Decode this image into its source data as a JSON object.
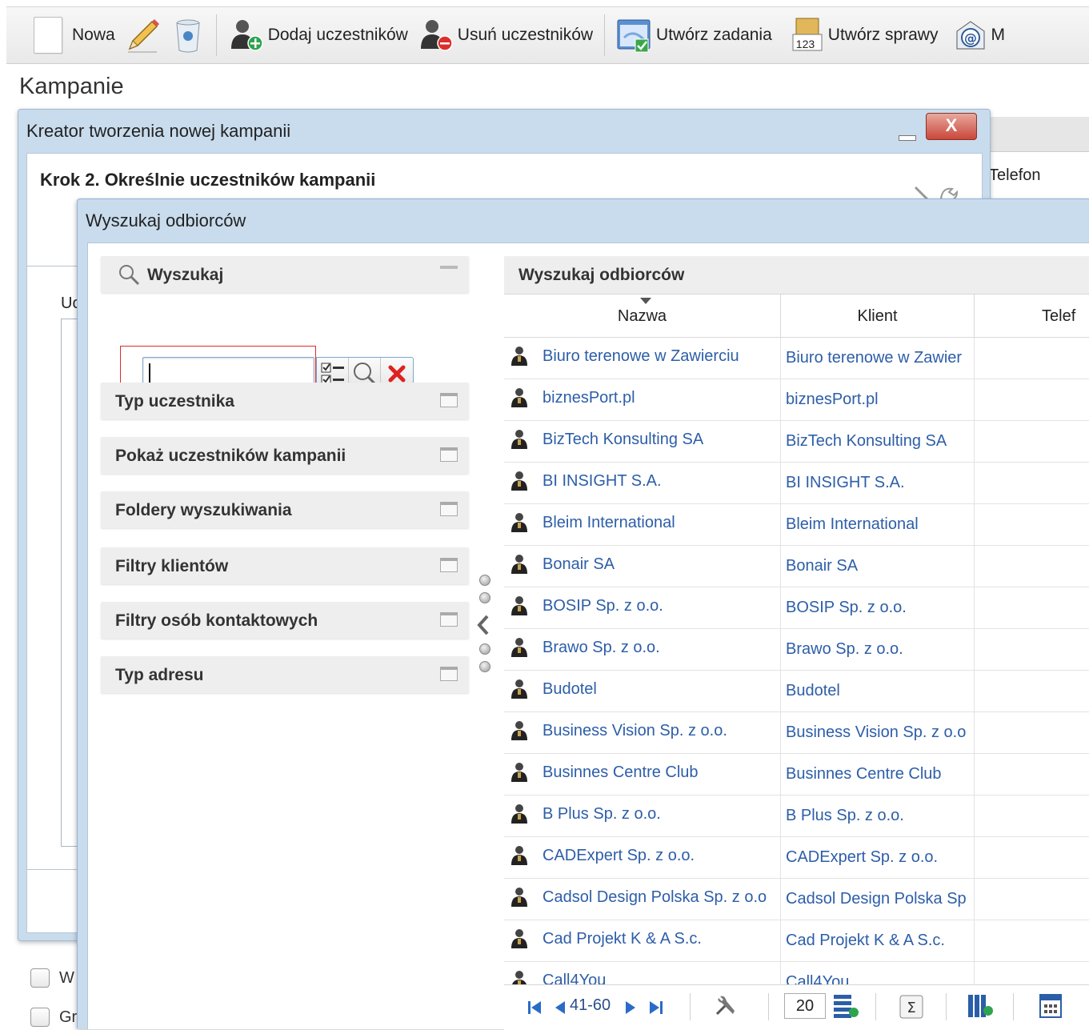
{
  "toolbar": {
    "new_label": "Nowa",
    "add_participants": "Dodaj uczestników",
    "remove_participants": "Usuń uczestników",
    "create_tasks": "Utwórz zadania",
    "create_cases": "Utwórz sprawy",
    "cases_icon_number": "123",
    "mail_label": "M"
  },
  "page_title": "Kampanie",
  "outer_window": {
    "title": "Kreator tworzenia nowej kampanii",
    "close_glyph": "X",
    "step_title": "Krok 2. Określnie uczestników kampanii",
    "ud_label": "Uc",
    "bg_column": "Telefon",
    "bottom_items": [
      "W",
      "Gr"
    ]
  },
  "inner_window": {
    "title": "Wyszukaj odbiorców",
    "search_panel_title": "Wyszukaj",
    "search_value": "",
    "panels": [
      "Typ uczestnika",
      "Pokaż uczestników kampanii",
      "Foldery wyszukiwania",
      "Filtry klientów",
      "Filtry osób kontaktowych",
      "Typ adresu"
    ]
  },
  "grid": {
    "title": "Wyszukaj odbiorców",
    "columns": [
      "Nazwa",
      "Klient",
      "Telef"
    ],
    "rows": [
      {
        "name": "Biuro terenowe w Zawierciu",
        "client": "Biuro terenowe w Zawier"
      },
      {
        "name": "biznesPort.pl",
        "client": "biznesPort.pl"
      },
      {
        "name": "BizTech Konsulting SA",
        "client": "BizTech Konsulting SA"
      },
      {
        "name": "BI INSIGHT S.A.",
        "client": "BI INSIGHT S.A."
      },
      {
        "name": "Bleim International",
        "client": "Bleim International"
      },
      {
        "name": "Bonair SA",
        "client": "Bonair SA"
      },
      {
        "name": "BOSIP Sp. z o.o.",
        "client": "BOSIP Sp. z o.o."
      },
      {
        "name": "Brawo Sp. z o.o.",
        "client": "Brawo Sp. z o.o."
      },
      {
        "name": "Budotel",
        "client": "Budotel"
      },
      {
        "name": "Business Vision Sp. z o.o.",
        "client": "Business Vision Sp. z o.o"
      },
      {
        "name": "Businnes Centre Club",
        "client": "Businnes Centre Club"
      },
      {
        "name": "B Plus Sp. z o.o.",
        "client": "B Plus Sp. z o.o."
      },
      {
        "name": "CADExpert Sp. z o.o.",
        "client": "CADExpert Sp. z o.o."
      },
      {
        "name": "Cadsol Design Polska Sp. z o.o",
        "client": "Cadsol Design Polska Sp"
      },
      {
        "name": "Cad Projekt K & A S.c.",
        "client": "Cad Projekt K & A S.c."
      },
      {
        "name": "Call4You",
        "client": "Call4You"
      }
    ],
    "pager": {
      "range": "41-60",
      "page_size": "20"
    }
  }
}
